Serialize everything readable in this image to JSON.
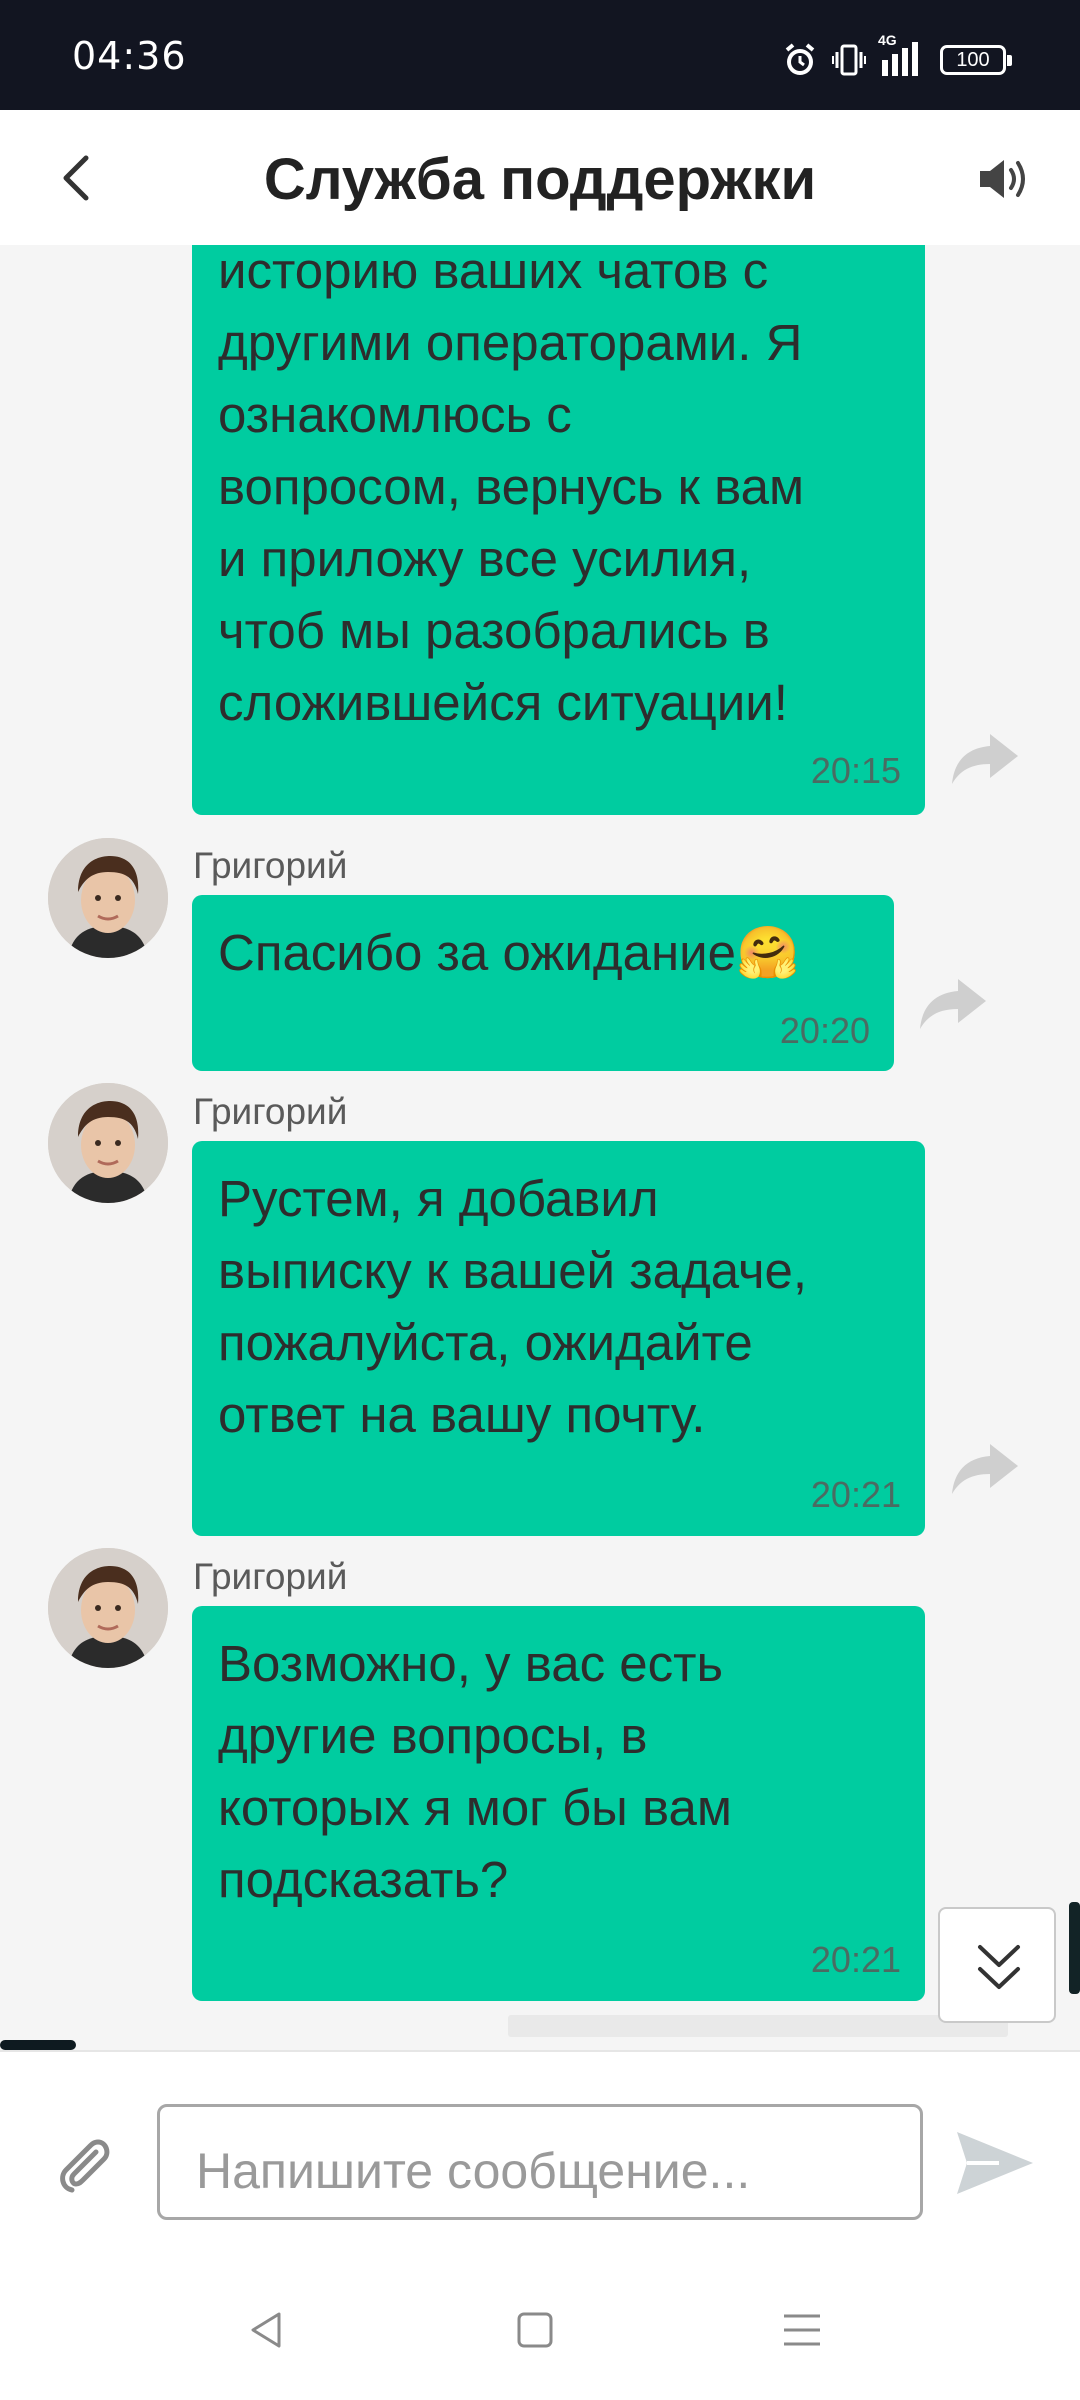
{
  "status_bar": {
    "time": "04:36",
    "network_label": "4G",
    "battery_level": "100",
    "icons": [
      "alarm-icon",
      "vibrate-icon",
      "signal-icon",
      "battery-icon"
    ]
  },
  "header": {
    "title": "Служба поддержки",
    "back_icon": "chevron-left-icon",
    "sound_icon": "speaker-icon"
  },
  "messages": [
    {
      "sender": "",
      "text": "историю ваших чатов с\nдругими операторами. Я\nознакомлюсь с\nвопросом, вернусь к вам\nи приложу все усилия,\nчтоб мы разобрались в\nсложившейся ситуации!",
      "time": "20:15"
    },
    {
      "sender": "Григорий",
      "text": "Спасибо за ожидание🤗",
      "time": "20:20"
    },
    {
      "sender": "Григорий",
      "text": "Рустем, я добавил\nвыписку к вашей задаче,\nпожалуйста, ожидайте\nответ на вашу почту.",
      "time": "20:21"
    },
    {
      "sender": "Григорий",
      "text": "Возможно, у вас есть\nдругие вопросы, в\nкоторых я мог бы вам\nподсказать?",
      "time": "20:21"
    }
  ],
  "composer": {
    "placeholder": "Напишите сообщение...",
    "value": ""
  },
  "colors": {
    "bubble": "#00cca0",
    "status_bar": "#121521",
    "background": "#f5f5f5"
  }
}
